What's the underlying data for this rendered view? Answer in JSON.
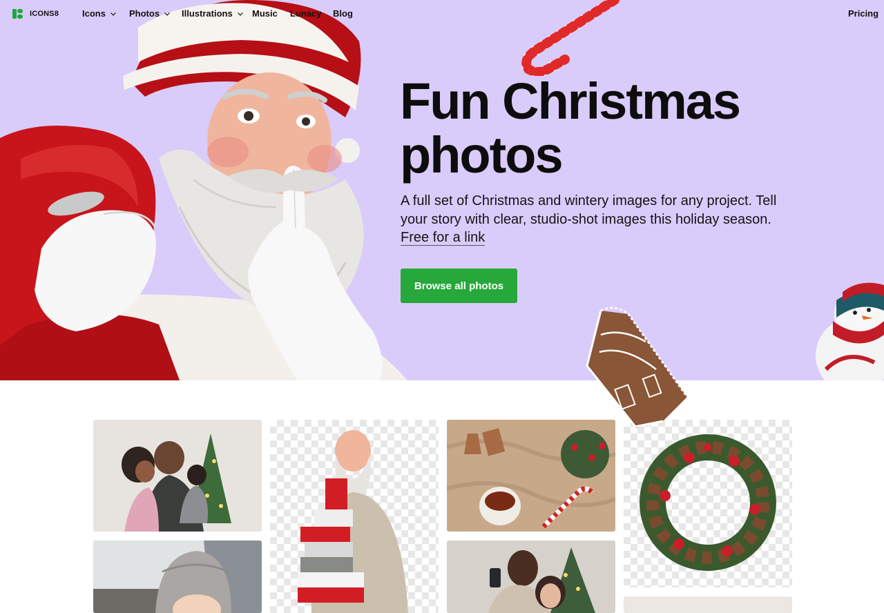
{
  "nav": {
    "brand": "ICONS8",
    "items": [
      {
        "label": "Icons",
        "dropdown": true
      },
      {
        "label": "Photos",
        "dropdown": true
      },
      {
        "label": "Illustrations",
        "dropdown": true
      },
      {
        "label": "Music",
        "dropdown": false
      },
      {
        "label": "Lunacy",
        "dropdown": false
      },
      {
        "label": "Blog",
        "dropdown": false
      }
    ],
    "pricing": "Pricing"
  },
  "hero": {
    "title_line1": "Fun Christmas",
    "title_line2": "photos",
    "description": "A full set of Christmas and wintery images for any project. Tell your story with clear, studio-shot images this holiday season.",
    "link_text": "Free for a link",
    "button_label": "Browse all photos"
  },
  "colors": {
    "hero_bg": "#d9ccfb",
    "brand_green": "#26a83a"
  },
  "icons": [
    "icons8-logo",
    "chevron-down-icon"
  ]
}
